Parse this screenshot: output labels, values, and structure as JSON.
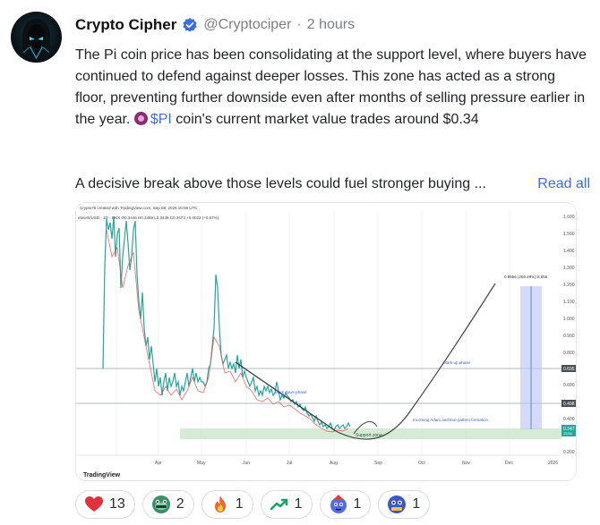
{
  "post": {
    "author_name": "Crypto Cipher",
    "handle": "@Cryptociper",
    "separator": "·",
    "time_ago": "2 hours",
    "para1_a": "The Pi coin price has been consolidating at the support level, where buyers have continued to defend against deeper losses. This zone has acted as a strong floor, preventing further downside even after months of selling pressure earlier in the year.",
    "ticker": "$PI",
    "para1_b": "coin's current market value trades around $0.34",
    "teaser": "A decisive break above those levels could fuel stronger buying",
    "ellipsis": "...",
    "read_all": "Read all"
  },
  "chart": {
    "header_line1": "Crypto76 created with TradingView.com, Sep 08, 2025 10:08 UTC",
    "header_line2": "etwork/USD · 1D · OKX  O0.3446  H0.3489  L0.3446  C0.3473  +0.0022 (+0.67%)",
    "watermark": "TradingView",
    "x_labels": [
      "Apr",
      "May",
      "Jun",
      "Jul",
      "Aug",
      "Sep",
      "Oct",
      "Nov",
      "Dec",
      "2026"
    ],
    "y_labels": [
      "1.600",
      "1.500",
      "1.400",
      "1.300",
      "1.200",
      "1.100",
      "1.000",
      "0.900",
      "0.800",
      "0.700",
      "0.600",
      "0.500",
      "0.400",
      "0.300",
      "0.200"
    ],
    "price_tags": {
      "upper": "0.695",
      "mid": "0.498",
      "last": "0.347",
      "last_sub": "15:51"
    },
    "annotations": {
      "measure": "0.8556 (250.29%) 8,556",
      "markup": "Mark-up phase",
      "markdown": "Mark down phase",
      "pattern": "Incoming Adam and Eve pattern formation",
      "support": "Support zone"
    },
    "colors": {
      "up": "#26a69a",
      "down": "#ef5350",
      "projection": "#6a7ee8",
      "support": "#cfe8cf"
    }
  },
  "reactions": [
    {
      "icon": "heart-icon",
      "count": "13"
    },
    {
      "icon": "moon-frog-icon",
      "count": "2"
    },
    {
      "icon": "fire-icon",
      "count": "1"
    },
    {
      "icon": "trending-up-icon",
      "count": "1"
    },
    {
      "icon": "rocket-mascot-icon",
      "count": "1"
    },
    {
      "icon": "pump-mascot-icon",
      "count": "1"
    }
  ]
}
